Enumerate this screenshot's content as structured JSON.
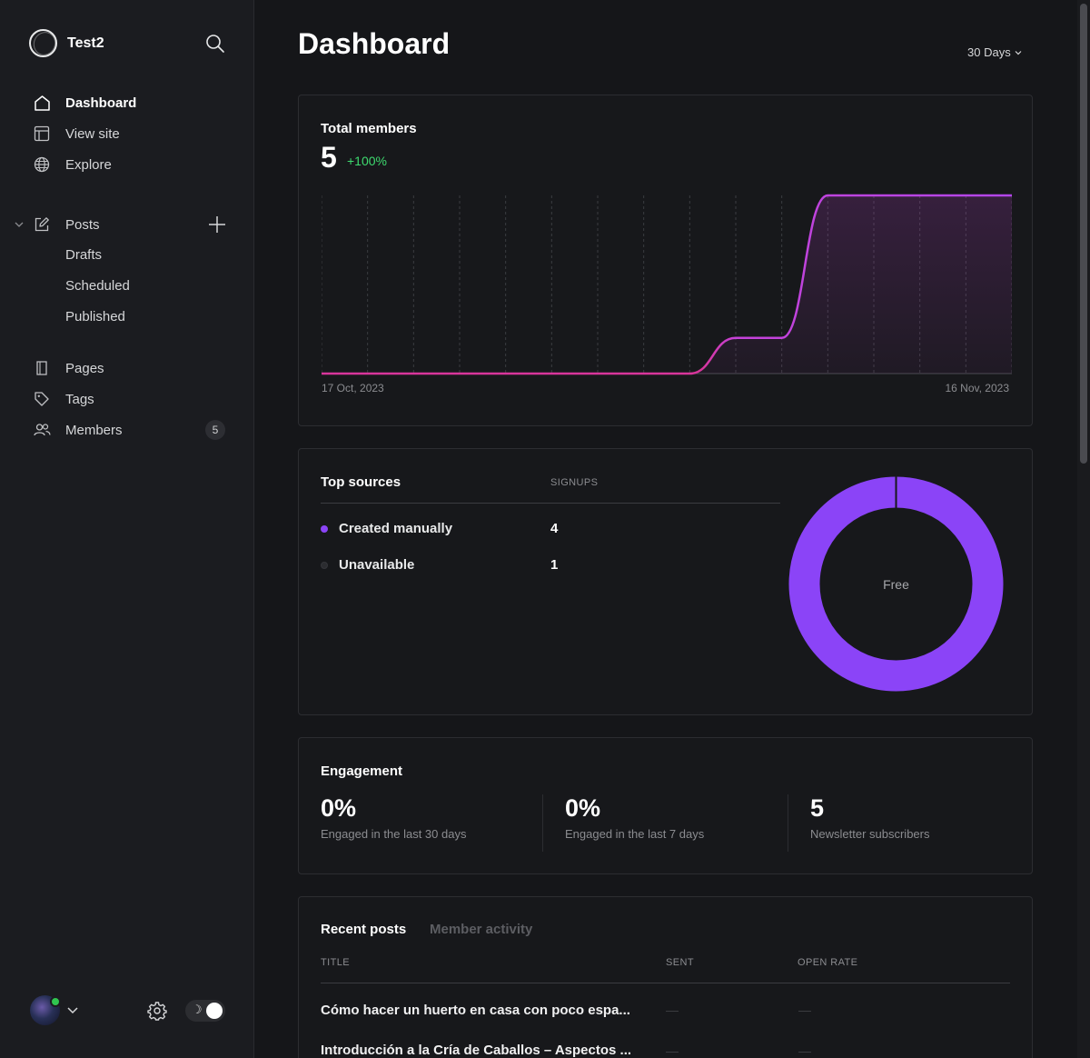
{
  "sidebar": {
    "site_name": "Test2",
    "nav": [
      {
        "label": "Dashboard",
        "icon": "home-icon",
        "active": true
      },
      {
        "label": "View site",
        "icon": "layout-icon"
      },
      {
        "label": "Explore",
        "icon": "globe-icon"
      }
    ],
    "posts": {
      "label": "Posts",
      "icon": "edit-icon",
      "sub": [
        "Drafts",
        "Scheduled",
        "Published"
      ]
    },
    "secondary": [
      {
        "label": "Pages",
        "icon": "page-icon"
      },
      {
        "label": "Tags",
        "icon": "tag-icon"
      },
      {
        "label": "Members",
        "icon": "members-icon"
      }
    ],
    "members_count": "5",
    "theme_icon": "☽"
  },
  "header": {
    "title": "Dashboard",
    "range": "30 Days"
  },
  "members_card": {
    "title": "Total members",
    "value": "5",
    "delta": "+100%",
    "date_start": "17 Oct, 2023",
    "date_end": "16 Nov, 2023",
    "line_color": "#c542d9"
  },
  "chart_data": {
    "type": "line",
    "x": [
      "17 Oct, 2023",
      "16 Nov, 2023"
    ],
    "series": [
      {
        "values": [
          0,
          0,
          0,
          0,
          0,
          0,
          0,
          0,
          0,
          1,
          1,
          5,
          5,
          5,
          5,
          5
        ]
      }
    ],
    "title": "Total members",
    "grid": true
  },
  "sources_card": {
    "title": "Top sources",
    "col_signups": "SIGNUPS",
    "rows": [
      {
        "name": "Created manually",
        "value": "4",
        "color": "#8b44f7"
      },
      {
        "name": "Unavailable",
        "value": "1",
        "color": "#2b2c30"
      }
    ],
    "donut_label": "Free",
    "donut_color": "#8b44f7"
  },
  "engagement_card": {
    "title": "Engagement",
    "stats": [
      {
        "value": "0%",
        "label": "Engaged in the last 30 days"
      },
      {
        "value": "0%",
        "label": "Engaged in the last 7 days"
      },
      {
        "value": "5",
        "label": "Newsletter subscribers"
      }
    ]
  },
  "posts_card": {
    "tabs": [
      "Recent posts",
      "Member activity"
    ],
    "cols": [
      "TITLE",
      "SENT",
      "OPEN RATE"
    ],
    "rows": [
      {
        "title": "Cómo hacer un huerto en casa con poco espa..."
      },
      {
        "title": "Introducción a la Cría de Caballos – Aspectos ..."
      }
    ]
  }
}
